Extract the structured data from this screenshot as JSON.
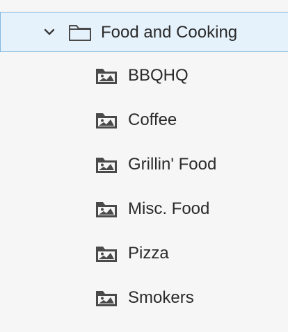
{
  "tree": {
    "parent": {
      "label": "Food and Cooking",
      "expanded": true,
      "icon": "folder-icon",
      "chevron": "chevron-down-icon"
    },
    "children": [
      {
        "label": "BBQHQ",
        "icon": "image-folder-icon"
      },
      {
        "label": "Coffee",
        "icon": "image-folder-icon"
      },
      {
        "label": "Grillin' Food",
        "icon": "image-folder-icon"
      },
      {
        "label": "Misc. Food",
        "icon": "image-folder-icon"
      },
      {
        "label": "Pizza",
        "icon": "image-folder-icon"
      },
      {
        "label": "Smokers",
        "icon": "image-folder-icon"
      }
    ]
  },
  "colors": {
    "background": "#f6f6f6",
    "selected_row": "#e6f2fb",
    "selected_border": "#7fb7e2",
    "icon": "#4a4a4a",
    "text": "#2a2a2a"
  }
}
